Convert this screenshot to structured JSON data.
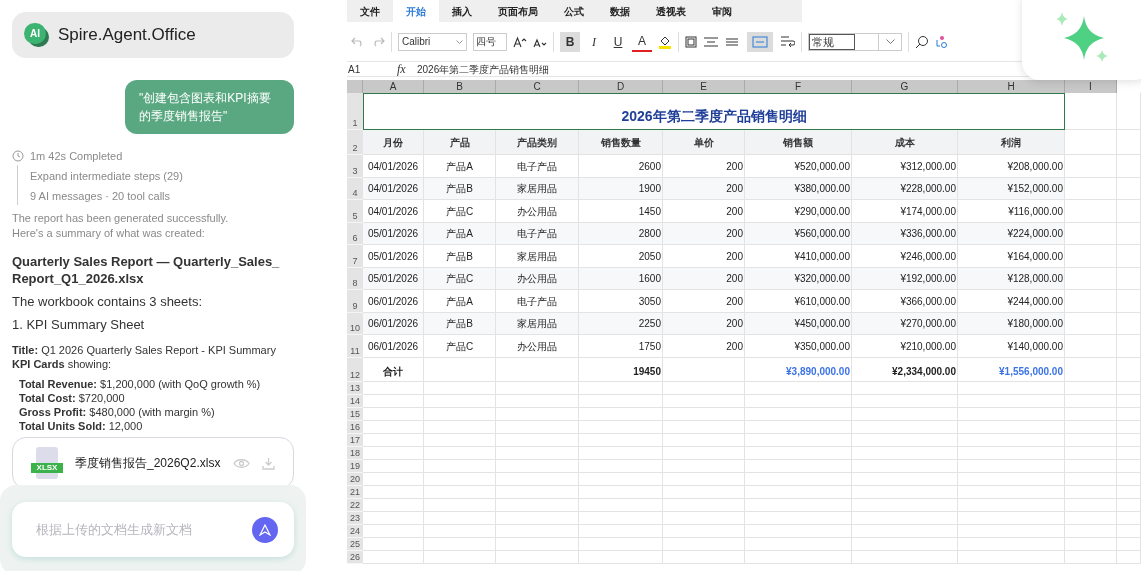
{
  "app": {
    "title": "Spire.Agent.Office",
    "logo": "AI"
  },
  "chat": {
    "user_message": "\"创建包含图表和KPI摘要的季度销售报告\"",
    "run": {
      "status": "1m 42s Completed",
      "steps": [
        "Expand intermediate steps (29)",
        "9 AI messages · 20 tool calls"
      ]
    },
    "blocks": [
      {
        "kind": "note",
        "text": "The report has been generated successfully."
      },
      {
        "kind": "note",
        "text": "Here's a summary of what was created:"
      },
      {
        "kind": "heading",
        "text": "Quarterly Sales Report — Quarterly_Sales_Report_Q1_2026.xlsx"
      },
      {
        "kind": "body",
        "text": "The workbook contains 3 sheets:"
      },
      {
        "kind": "body",
        "text": "1. KPI Summary Sheet"
      },
      {
        "kind": "small",
        "text": "**Title:** Q1 2026 Quarterly Sales Report - KPI Summary"
      },
      {
        "kind": "small",
        "text": "**KPI Cards** showing:"
      },
      {
        "kind": "bullet",
        "text": "**Total Revenue:** $1,200,000 (with QoQ growth %)"
      },
      {
        "kind": "bullet",
        "text": "**Total Cost:** $720,000"
      },
      {
        "kind": "bullet",
        "text": "**Gross Profit:** $480,000 (with margin %)"
      },
      {
        "kind": "bullet",
        "text": "**Total Units Sold:** 12,000"
      }
    ],
    "file": {
      "badge": "XLSX",
      "name": "季度销售报告_2026Q2.xlsx"
    },
    "input": {
      "placeholder": "根据上传的文档生成新文档"
    }
  },
  "sheet": {
    "tabs": [
      {
        "label": "文件",
        "selected": false
      },
      {
        "label": "开始",
        "selected": true
      },
      {
        "label": "插入",
        "selected": false
      },
      {
        "label": "页面布局",
        "selected": false
      },
      {
        "label": "公式",
        "selected": false
      },
      {
        "label": "数据",
        "selected": false
      },
      {
        "label": "透视表",
        "selected": false
      },
      {
        "label": "审阅",
        "selected": false
      }
    ],
    "toolbar": {
      "font": "Calibri",
      "size": "四号",
      "style": "常规",
      "format_buttons": [
        {
          "label": "B",
          "pressed": true
        },
        {
          "label": "I",
          "pressed": false
        },
        {
          "label": "U",
          "pressed": false
        },
        {
          "label": "A",
          "pressed": false
        }
      ],
      "merge_pressed": true
    },
    "cell_ref": "A1",
    "fx": "fx",
    "formula": "2026年第二季度产品销售明细",
    "columns": [
      "A",
      "B",
      "C",
      "D",
      "E",
      "F",
      "G",
      "H",
      "I"
    ],
    "row_numbers": [
      "1",
      "2",
      "3",
      "4",
      "5",
      "6",
      "7",
      "8",
      "9",
      "10",
      "11",
      "12",
      "13",
      "14",
      "15",
      "16",
      "17",
      "18",
      "19",
      "20",
      "21",
      "22",
      "23",
      "24",
      "25",
      "26"
    ],
    "title": "2026年第二季度产品销售明细",
    "headers": [
      "月份",
      "产品",
      "产品类别",
      "销售数量",
      "单价",
      "销售额",
      "成本",
      "利润"
    ],
    "rows": [
      [
        "04/01/2026",
        "产品A",
        "电子产品",
        "2600",
        "200",
        "¥520,000.00",
        "¥312,000.00",
        "¥208,000.00"
      ],
      [
        "04/01/2026",
        "产品B",
        "家居用品",
        "1900",
        "200",
        "¥380,000.00",
        "¥228,000.00",
        "¥152,000.00"
      ],
      [
        "04/01/2026",
        "产品C",
        "办公用品",
        "1450",
        "200",
        "¥290,000.00",
        "¥174,000.00",
        "¥116,000.00"
      ],
      [
        "05/01/2026",
        "产品A",
        "电子产品",
        "2800",
        "200",
        "¥560,000.00",
        "¥336,000.00",
        "¥224,000.00"
      ],
      [
        "05/01/2026",
        "产品B",
        "家居用品",
        "2050",
        "200",
        "¥410,000.00",
        "¥246,000.00",
        "¥164,000.00"
      ],
      [
        "05/01/2026",
        "产品C",
        "办公用品",
        "1600",
        "200",
        "¥320,000.00",
        "¥192,000.00",
        "¥128,000.00"
      ],
      [
        "06/01/2026",
        "产品A",
        "电子产品",
        "3050",
        "200",
        "¥610,000.00",
        "¥366,000.00",
        "¥244,000.00"
      ],
      [
        "06/01/2026",
        "产品B",
        "家居用品",
        "2250",
        "200",
        "¥450,000.00",
        "¥270,000.00",
        "¥180,000.00"
      ],
      [
        "06/01/2026",
        "产品C",
        "办公用品",
        "1750",
        "200",
        "¥350,000.00",
        "¥210,000.00",
        "¥140,000.00"
      ]
    ],
    "total": {
      "label": "合计",
      "quantity": {
        "text": "19450",
        "color": "#1f1f1f"
      },
      "sales": {
        "text": "¥3,890,000.00",
        "color": "#3b73e6"
      },
      "cost": {
        "text": "¥2,334,000.00",
        "color": "#1f1f1f"
      },
      "profit": {
        "text": "¥1,556,000.00",
        "color": "#3b73e6"
      }
    }
  }
}
